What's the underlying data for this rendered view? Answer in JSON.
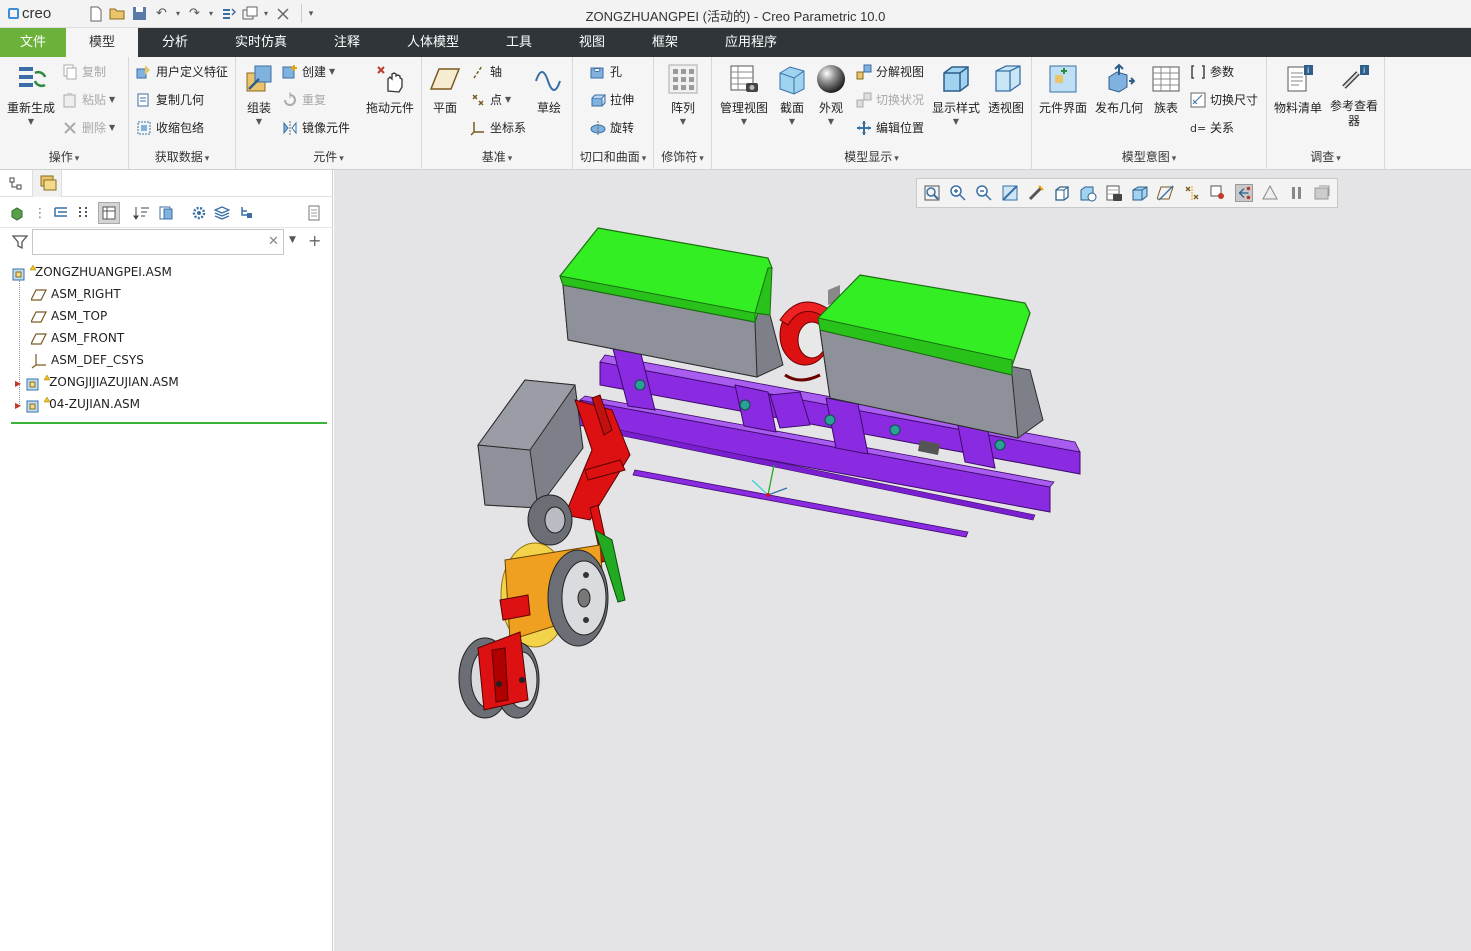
{
  "app": {
    "logo": "creo",
    "window_title": "ZONGZHUANGPEI (活动的) - Creo Parametric 10.0"
  },
  "tabs": [
    {
      "label": "文件",
      "kind": "file"
    },
    {
      "label": "模型",
      "kind": "active"
    },
    {
      "label": "分析"
    },
    {
      "label": "实时仿真"
    },
    {
      "label": "注释"
    },
    {
      "label": "人体模型"
    },
    {
      "label": "工具"
    },
    {
      "label": "视图"
    },
    {
      "label": "框架"
    },
    {
      "label": "应用程序"
    }
  ],
  "ribbon": {
    "ops": {
      "label": "操作",
      "regenerate": "重新生成",
      "copy": "复制",
      "paste": "粘贴",
      "delete": "删除"
    },
    "getdata": {
      "label": "获取数据",
      "udf": "用户定义特征",
      "copygeom": "复制几何",
      "shrinkwrap": "收缩包络"
    },
    "component": {
      "label": "元件",
      "assemble": "组装",
      "create": "创建",
      "repeat": "重复",
      "mirror": "镜像元件",
      "drag": "拖动元件"
    },
    "datum": {
      "label": "基准",
      "plane": "平面",
      "axis": "轴",
      "point": "点",
      "csys": "坐标系",
      "sketch": "草绘"
    },
    "cutsurf": {
      "label": "切口和曲面",
      "hole": "孔",
      "extrude": "拉伸",
      "revolve": "旋转"
    },
    "modifier": {
      "label": "修饰符",
      "pattern": "阵列"
    },
    "display": {
      "label": "模型显示",
      "manage": "管理视图",
      "section": "截面",
      "appearance": "外观",
      "explode": "分解视图",
      "togglestate": "切换状况",
      "editpos": "编辑位置",
      "style": "显示样式",
      "perspective": "透视图"
    },
    "intent": {
      "label": "模型意图",
      "interface": "元件界面",
      "publish": "发布几何",
      "family": "族表",
      "params": "参数",
      "toggledim": "切换尺寸",
      "relations": "关系"
    },
    "investigate": {
      "label": "调查",
      "bom": "物料清单",
      "refviewer": "参考查看器"
    }
  },
  "search": {
    "value": ""
  },
  "tree": [
    {
      "label": "ZONGZHUANGPEI.ASM",
      "type": "asm-root"
    },
    {
      "label": "ASM_RIGHT",
      "type": "plane"
    },
    {
      "label": "ASM_TOP",
      "type": "plane"
    },
    {
      "label": "ASM_FRONT",
      "type": "plane"
    },
    {
      "label": "ASM_DEF_CSYS",
      "type": "csys"
    },
    {
      "label": "ZONGJIJIAZUJIAN.ASM",
      "type": "asm"
    },
    {
      "label": "04-ZUJIAN.ASM",
      "type": "asm"
    }
  ],
  "colors": {
    "tab_bar": "#2f3538",
    "file_tab": "#6bb13a",
    "frame_purple": "#8a2be2",
    "hopper_lid": "#33ee22",
    "hopper_body": "#7d8088",
    "red_parts": "#dd1111",
    "orange_parts": "#f0a020",
    "viewport_bg": "#e4e4e6"
  },
  "icons": [
    "refit-icon",
    "zoom-in-icon",
    "zoom-out-icon",
    "repaint-icon",
    "shading-icon",
    "style-icon",
    "saved-orientations-icon",
    "view-manager-icon",
    "perspective-icon",
    "datum-display-icon",
    "annotation-display-icon",
    "spin-center-icon",
    "pause-icon"
  ]
}
